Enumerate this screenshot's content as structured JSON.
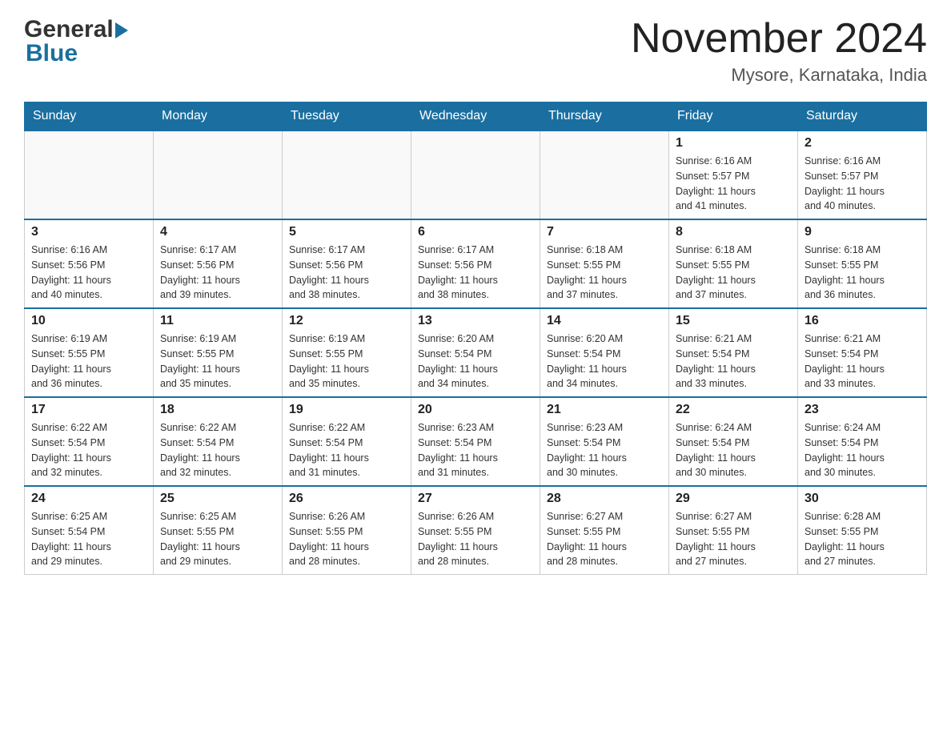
{
  "header": {
    "logo_general": "General",
    "logo_blue": "Blue",
    "month_title": "November 2024",
    "location": "Mysore, Karnataka, India"
  },
  "weekdays": [
    "Sunday",
    "Monday",
    "Tuesday",
    "Wednesday",
    "Thursday",
    "Friday",
    "Saturday"
  ],
  "weeks": [
    [
      {
        "day": "",
        "info": ""
      },
      {
        "day": "",
        "info": ""
      },
      {
        "day": "",
        "info": ""
      },
      {
        "day": "",
        "info": ""
      },
      {
        "day": "",
        "info": ""
      },
      {
        "day": "1",
        "info": "Sunrise: 6:16 AM\nSunset: 5:57 PM\nDaylight: 11 hours\nand 41 minutes."
      },
      {
        "day": "2",
        "info": "Sunrise: 6:16 AM\nSunset: 5:57 PM\nDaylight: 11 hours\nand 40 minutes."
      }
    ],
    [
      {
        "day": "3",
        "info": "Sunrise: 6:16 AM\nSunset: 5:56 PM\nDaylight: 11 hours\nand 40 minutes."
      },
      {
        "day": "4",
        "info": "Sunrise: 6:17 AM\nSunset: 5:56 PM\nDaylight: 11 hours\nand 39 minutes."
      },
      {
        "day": "5",
        "info": "Sunrise: 6:17 AM\nSunset: 5:56 PM\nDaylight: 11 hours\nand 38 minutes."
      },
      {
        "day": "6",
        "info": "Sunrise: 6:17 AM\nSunset: 5:56 PM\nDaylight: 11 hours\nand 38 minutes."
      },
      {
        "day": "7",
        "info": "Sunrise: 6:18 AM\nSunset: 5:55 PM\nDaylight: 11 hours\nand 37 minutes."
      },
      {
        "day": "8",
        "info": "Sunrise: 6:18 AM\nSunset: 5:55 PM\nDaylight: 11 hours\nand 37 minutes."
      },
      {
        "day": "9",
        "info": "Sunrise: 6:18 AM\nSunset: 5:55 PM\nDaylight: 11 hours\nand 36 minutes."
      }
    ],
    [
      {
        "day": "10",
        "info": "Sunrise: 6:19 AM\nSunset: 5:55 PM\nDaylight: 11 hours\nand 36 minutes."
      },
      {
        "day": "11",
        "info": "Sunrise: 6:19 AM\nSunset: 5:55 PM\nDaylight: 11 hours\nand 35 minutes."
      },
      {
        "day": "12",
        "info": "Sunrise: 6:19 AM\nSunset: 5:55 PM\nDaylight: 11 hours\nand 35 minutes."
      },
      {
        "day": "13",
        "info": "Sunrise: 6:20 AM\nSunset: 5:54 PM\nDaylight: 11 hours\nand 34 minutes."
      },
      {
        "day": "14",
        "info": "Sunrise: 6:20 AM\nSunset: 5:54 PM\nDaylight: 11 hours\nand 34 minutes."
      },
      {
        "day": "15",
        "info": "Sunrise: 6:21 AM\nSunset: 5:54 PM\nDaylight: 11 hours\nand 33 minutes."
      },
      {
        "day": "16",
        "info": "Sunrise: 6:21 AM\nSunset: 5:54 PM\nDaylight: 11 hours\nand 33 minutes."
      }
    ],
    [
      {
        "day": "17",
        "info": "Sunrise: 6:22 AM\nSunset: 5:54 PM\nDaylight: 11 hours\nand 32 minutes."
      },
      {
        "day": "18",
        "info": "Sunrise: 6:22 AM\nSunset: 5:54 PM\nDaylight: 11 hours\nand 32 minutes."
      },
      {
        "day": "19",
        "info": "Sunrise: 6:22 AM\nSunset: 5:54 PM\nDaylight: 11 hours\nand 31 minutes."
      },
      {
        "day": "20",
        "info": "Sunrise: 6:23 AM\nSunset: 5:54 PM\nDaylight: 11 hours\nand 31 minutes."
      },
      {
        "day": "21",
        "info": "Sunrise: 6:23 AM\nSunset: 5:54 PM\nDaylight: 11 hours\nand 30 minutes."
      },
      {
        "day": "22",
        "info": "Sunrise: 6:24 AM\nSunset: 5:54 PM\nDaylight: 11 hours\nand 30 minutes."
      },
      {
        "day": "23",
        "info": "Sunrise: 6:24 AM\nSunset: 5:54 PM\nDaylight: 11 hours\nand 30 minutes."
      }
    ],
    [
      {
        "day": "24",
        "info": "Sunrise: 6:25 AM\nSunset: 5:54 PM\nDaylight: 11 hours\nand 29 minutes."
      },
      {
        "day": "25",
        "info": "Sunrise: 6:25 AM\nSunset: 5:55 PM\nDaylight: 11 hours\nand 29 minutes."
      },
      {
        "day": "26",
        "info": "Sunrise: 6:26 AM\nSunset: 5:55 PM\nDaylight: 11 hours\nand 28 minutes."
      },
      {
        "day": "27",
        "info": "Sunrise: 6:26 AM\nSunset: 5:55 PM\nDaylight: 11 hours\nand 28 minutes."
      },
      {
        "day": "28",
        "info": "Sunrise: 6:27 AM\nSunset: 5:55 PM\nDaylight: 11 hours\nand 28 minutes."
      },
      {
        "day": "29",
        "info": "Sunrise: 6:27 AM\nSunset: 5:55 PM\nDaylight: 11 hours\nand 27 minutes."
      },
      {
        "day": "30",
        "info": "Sunrise: 6:28 AM\nSunset: 5:55 PM\nDaylight: 11 hours\nand 27 minutes."
      }
    ]
  ]
}
